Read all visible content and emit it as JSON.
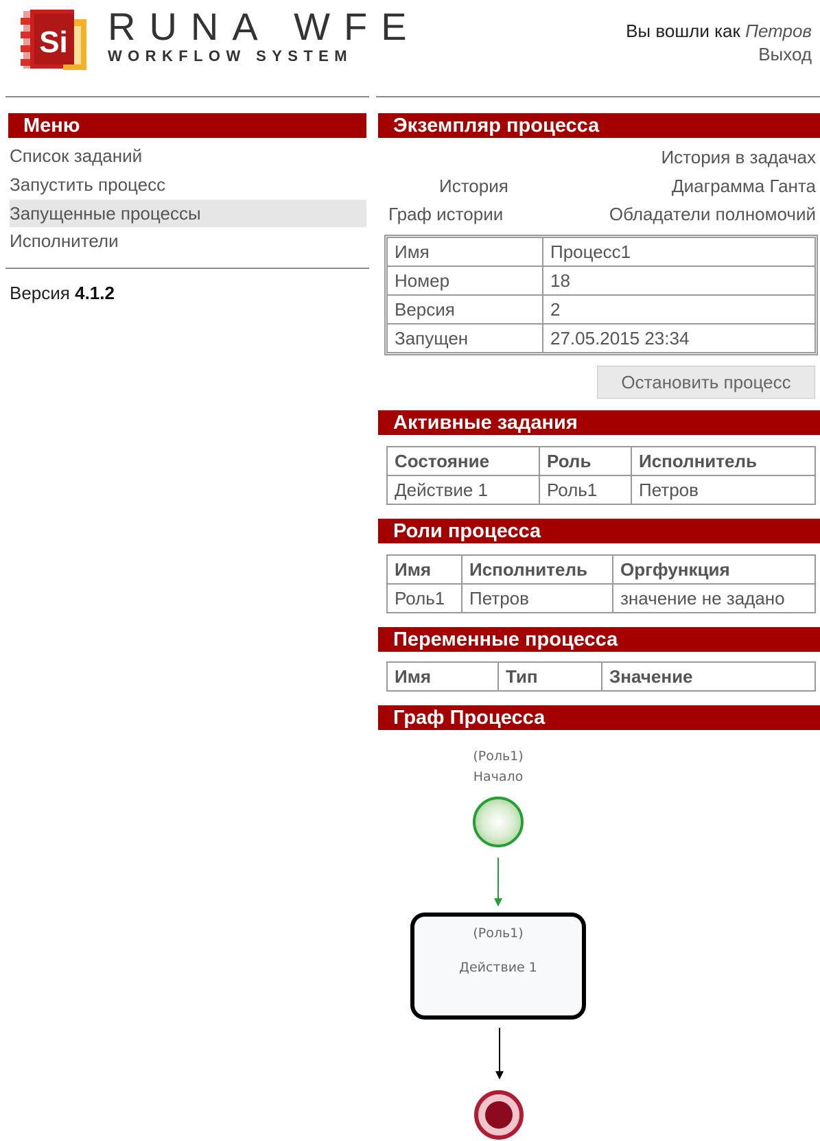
{
  "header": {
    "brand_name": "RUNA WFE",
    "brand_sub": "WORKFLOW SYSTEM",
    "logo_text": "Si",
    "login_prefix": "Вы вошли как",
    "user": "Петров",
    "logout": "Выход"
  },
  "menu": {
    "title": "Меню",
    "items": [
      "Список заданий",
      "Запустить процесс",
      "Запущенные процессы",
      "Исполнители"
    ],
    "active_index": 2,
    "version_label": "Версия",
    "version": "4.1.2"
  },
  "process": {
    "title": "Экземпляр процесса",
    "links": {
      "history_tasks": "История в задачах",
      "history": "История",
      "gantt": "Диаграмма Ганта",
      "history_graph": "Граф истории",
      "holders": "Обладатели полномочий"
    },
    "props": [
      {
        "label": "Имя",
        "value": "Процесс1"
      },
      {
        "label": "Номер",
        "value": "18"
      },
      {
        "label": "Версия",
        "value": "2"
      },
      {
        "label": "Запущен",
        "value": "27.05.2015 23:34"
      }
    ],
    "stop_button": "Остановить процесс"
  },
  "active_tasks": {
    "title": "Активные задания",
    "columns": [
      "Состояние",
      "Роль",
      "Исполнитель"
    ],
    "rows": [
      [
        "Действие 1",
        "Роль1",
        "Петров"
      ]
    ]
  },
  "roles": {
    "title": "Роли процесса",
    "columns": [
      "Имя",
      "Исполнитель",
      "Оргфункция"
    ],
    "rows": [
      [
        "Роль1",
        "Петров",
        "значение не задано"
      ]
    ]
  },
  "variables": {
    "title": "Переменные процесса",
    "columns": [
      "Имя",
      "Тип",
      "Значение"
    ]
  },
  "graph": {
    "title": "Граф Процесса",
    "start_role": "(Роль1)",
    "start_label": "Начало",
    "task_role": "(Роль1)",
    "task_label": "Действие 1",
    "colors": {
      "start": "#22a033",
      "end": "#8b0a1e",
      "task_border": "#000000"
    }
  }
}
